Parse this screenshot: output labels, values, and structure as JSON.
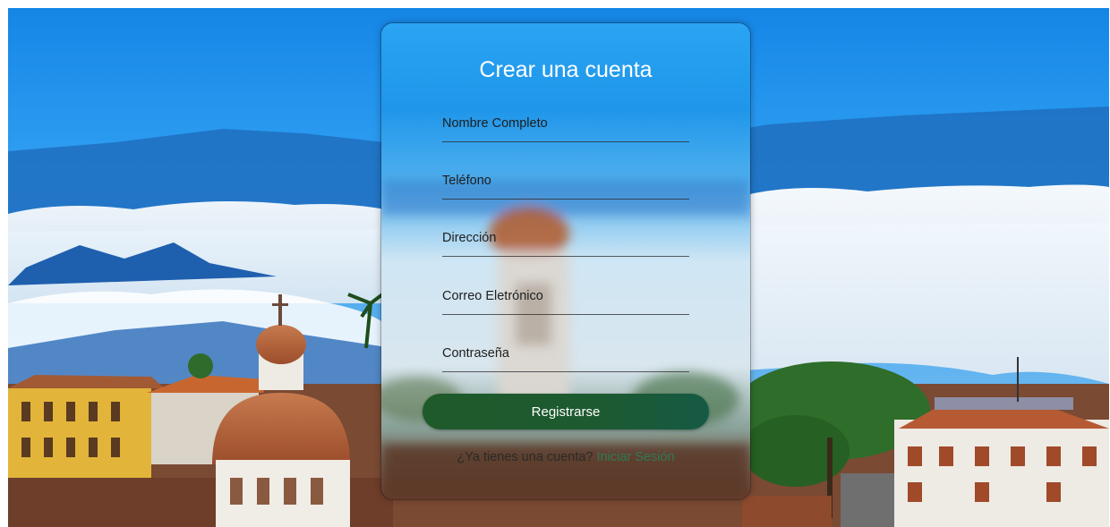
{
  "form": {
    "title": "Crear una cuenta",
    "fields": [
      {
        "label": "Nombre Completo"
      },
      {
        "label": "Teléfono"
      },
      {
        "label": "Dirección"
      },
      {
        "label": "Correo Eletrónico"
      },
      {
        "label": "Contraseña"
      }
    ],
    "submit_label": "Registrarse",
    "login_prompt": "¿Ya tienes una cuenta?",
    "login_link": "Iniciar Sesión"
  },
  "colors": {
    "sky": "#1e8fe0",
    "button": "#1f5a2c",
    "link": "#2e7a55"
  }
}
